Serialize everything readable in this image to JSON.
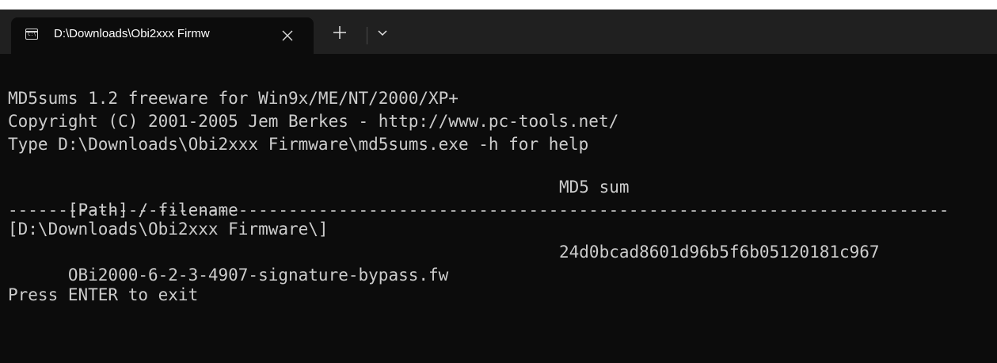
{
  "tab": {
    "title": "D:\\Downloads\\Obi2xxx Firmw",
    "close_symbol": "✕",
    "new_tab_symbol": "+",
    "dropdown_symbol": "⌄"
  },
  "console": {
    "lines": [
      "MD5sums 1.2 freeware for Win9x/ME/NT/2000/XP+",
      "Copyright (C) 2001-2005 Jem Berkes - http://www.pc-tools.net/",
      "Type D:\\Downloads\\Obi2xxx Firmware\\md5sums.exe -h for help"
    ],
    "header": {
      "path_col": "[Path] / filename",
      "md5_col": "MD5 sum"
    },
    "separator": "-------------------------------------------------------------------------------------------------",
    "directory": "[D:\\Downloads\\Obi2xxx Firmware\\]",
    "file": {
      "name": "OBi2000-6-2-3-4907-signature-bypass.fw",
      "md5": "24d0bcad8601d96b5f6b05120181c967"
    },
    "prompt": "Press ENTER to exit"
  }
}
